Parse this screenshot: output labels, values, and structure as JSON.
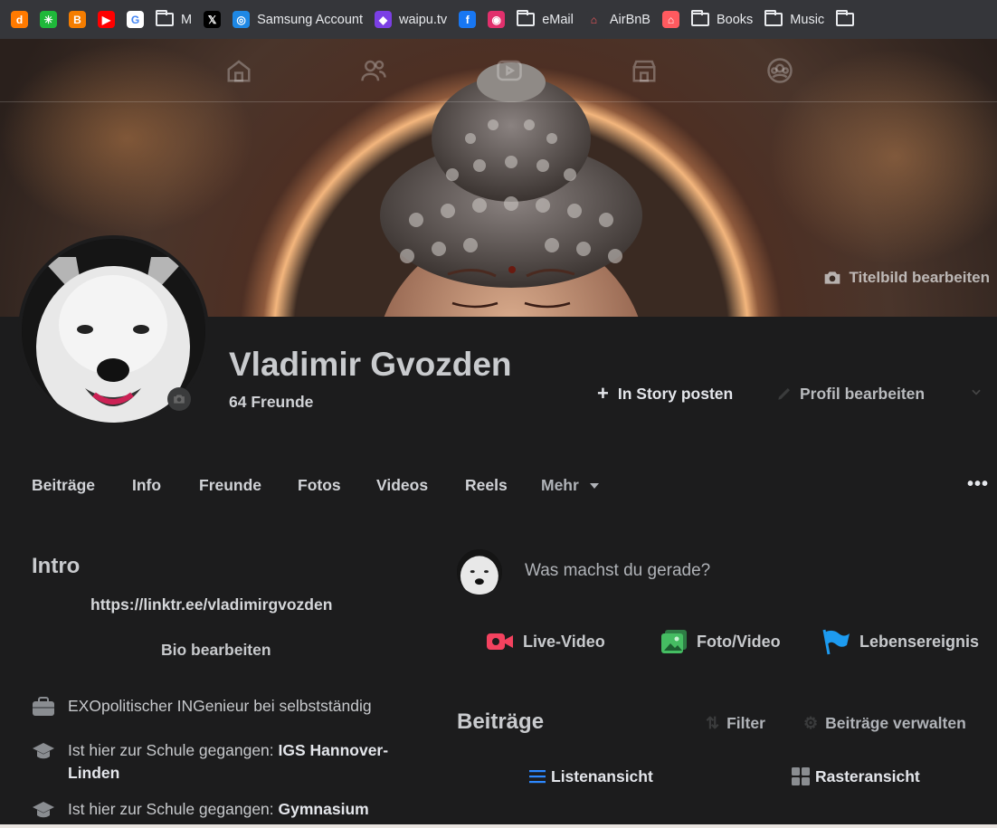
{
  "bookmarks": [
    {
      "icon": "dict-icon",
      "glyph": "d",
      "color": "#ff7a00",
      "label": ""
    },
    {
      "icon": "asterisk-icon",
      "glyph": "✳",
      "color": "#1fb83a",
      "label": ""
    },
    {
      "icon": "blogger-icon",
      "glyph": "B",
      "color": "#f57d00",
      "label": ""
    },
    {
      "icon": "youtube-icon",
      "glyph": "▶",
      "color": "#ff0000",
      "label": ""
    },
    {
      "icon": "google-icon",
      "glyph": "G",
      "color": "#ffffff",
      "label": ""
    },
    {
      "icon": "folder-icon",
      "folder": true,
      "label": "M"
    },
    {
      "icon": "x-icon",
      "glyph": "𝕏",
      "color": "#000000",
      "label": ""
    },
    {
      "icon": "samsung-account-icon",
      "glyph": "◎",
      "color": "#1e88e5",
      "label": "Samsung Account"
    },
    {
      "icon": "waipu-icon",
      "glyph": "◆",
      "color": "#7b3fe4",
      "label": "waipu.tv"
    },
    {
      "icon": "facebook-icon",
      "glyph": "f",
      "color": "#1877f2",
      "label": ""
    },
    {
      "icon": "instagram-icon",
      "glyph": "◉",
      "color": "#e1306c",
      "label": ""
    },
    {
      "icon": "folder-icon",
      "folder": true,
      "label": "eMail"
    },
    {
      "icon": "airbnb-icon",
      "glyph": "⌂",
      "color": "#35363a",
      "fg": "#ff5a5f",
      "label": "AirBnB"
    },
    {
      "icon": "airbnb-icon",
      "glyph": "⌂",
      "color": "#ff5a5f",
      "label": ""
    },
    {
      "icon": "folder-icon",
      "folder": true,
      "label": "Books"
    },
    {
      "icon": "folder-icon",
      "folder": true,
      "label": "Music"
    },
    {
      "icon": "folder-icon",
      "folder": true,
      "label": ""
    }
  ],
  "cover": {
    "edit_label": "Titelbild bearbeiten"
  },
  "profile": {
    "name": "Vladimir Gvozden",
    "friends": "64 Freunde",
    "story_button": "In Story posten",
    "edit_button": "Profil bearbeiten"
  },
  "tabs": {
    "items": [
      "Beiträge",
      "Info",
      "Freunde",
      "Fotos",
      "Videos",
      "Reels"
    ],
    "more": "Mehr"
  },
  "intro": {
    "title": "Intro",
    "link": "https://linktr.ee/vladimirgvozden",
    "bio_button": "Bio bearbeiten",
    "work": "EXOpolitischer INGenieur bei selbstständig",
    "school1_prefix": "Ist hier zur Schule gegangen: ",
    "school1_name": "IGS Hannover-",
    "school1_name2": "Linden",
    "school2_prefix": "Ist hier zur Schule gegangen: ",
    "school2_name": "Gymnasium"
  },
  "composer": {
    "placeholder": "Was machst du gerade?",
    "live_video": "Live-Video",
    "photo_video": "Foto/Video",
    "life_event": "Lebensereignis"
  },
  "posts": {
    "title": "Beiträge",
    "filter": "Filter",
    "manage": "Beiträge verwalten",
    "list_view": "Listenansicht",
    "grid_view": "Rasteransicht"
  },
  "colors": {
    "background": "#1c1c1d",
    "live_red": "#f3425f",
    "photo_green": "#45bd62",
    "event_blue": "#1d9bf0",
    "accent_blue": "#2d88ff"
  }
}
